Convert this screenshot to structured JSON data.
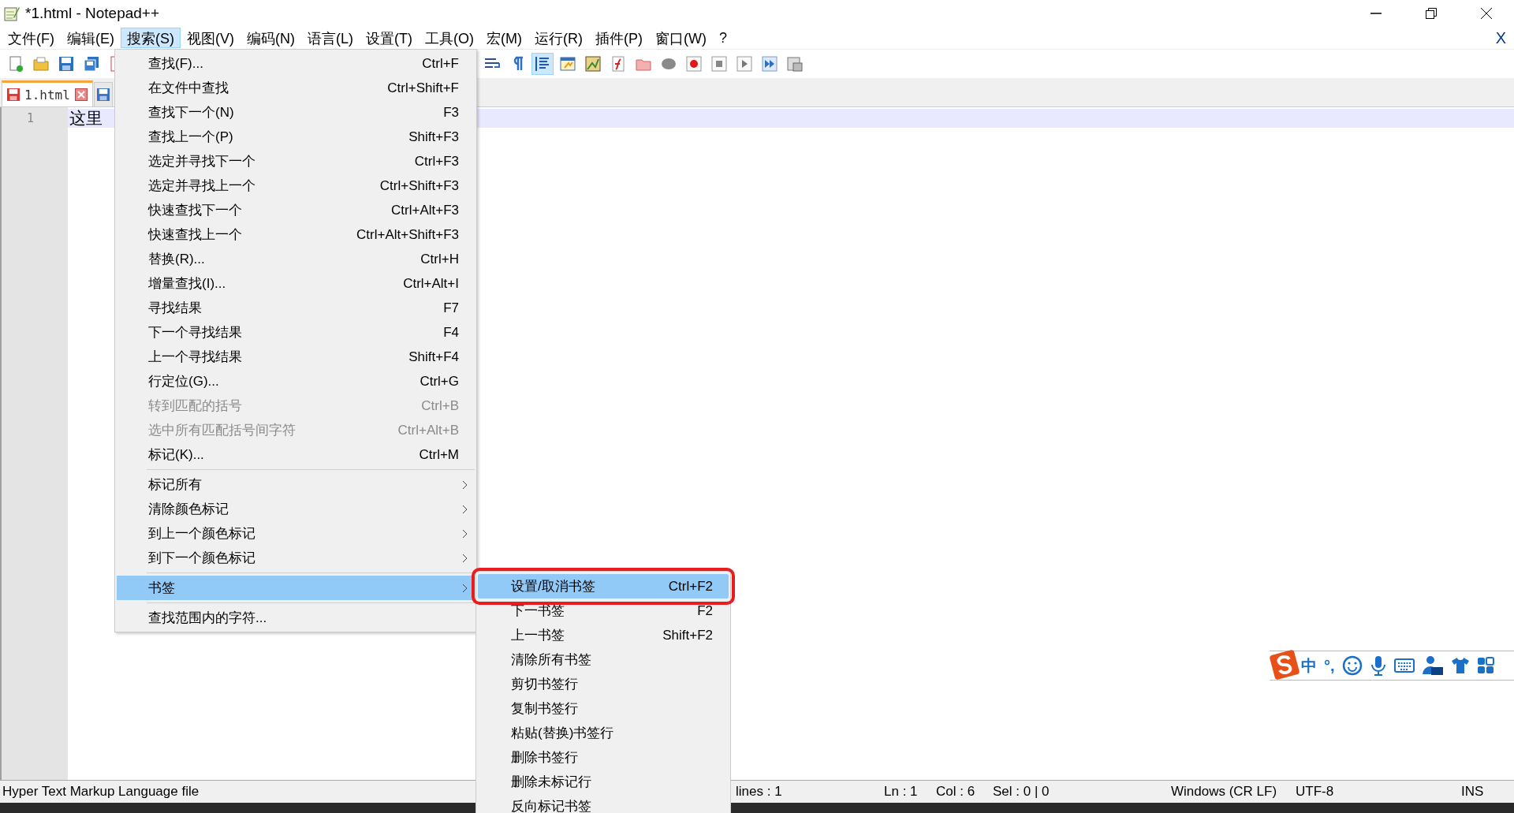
{
  "window": {
    "title": "*1.html - Notepad++"
  },
  "menubar": [
    {
      "label": "文件(F)",
      "selected": false
    },
    {
      "label": "编辑(E)",
      "selected": false
    },
    {
      "label": "搜索(S)",
      "selected": true
    },
    {
      "label": "视图(V)",
      "selected": false
    },
    {
      "label": "编码(N)",
      "selected": false
    },
    {
      "label": "语言(L)",
      "selected": false
    },
    {
      "label": "设置(T)",
      "selected": false
    },
    {
      "label": "工具(O)",
      "selected": false
    },
    {
      "label": "宏(M)",
      "selected": false
    },
    {
      "label": "运行(R)",
      "selected": false
    },
    {
      "label": "插件(P)",
      "selected": false
    },
    {
      "label": "窗口(W)",
      "selected": false
    },
    {
      "label": "?",
      "selected": false
    }
  ],
  "document_close": "X",
  "toolbar": [
    {
      "kind": "new",
      "pressed": false
    },
    {
      "kind": "open",
      "pressed": false
    },
    {
      "kind": "save",
      "pressed": false
    },
    {
      "kind": "save-all",
      "pressed": false
    },
    {
      "kind": "page",
      "pressed": false
    },
    {
      "kind": "wrap",
      "pressed": false
    },
    {
      "kind": "pilcrow",
      "pressed": false
    },
    {
      "kind": "indent",
      "pressed": true
    },
    {
      "kind": "window",
      "pressed": false
    },
    {
      "kind": "map",
      "pressed": false
    },
    {
      "kind": "function",
      "pressed": false
    },
    {
      "kind": "folder",
      "pressed": false
    },
    {
      "kind": "blob",
      "pressed": false
    },
    {
      "kind": "record",
      "pressed": false
    },
    {
      "kind": "stop",
      "pressed": false
    },
    {
      "kind": "play",
      "pressed": false
    },
    {
      "kind": "fast-forward",
      "pressed": false
    },
    {
      "kind": "list",
      "pressed": false
    }
  ],
  "tabs": [
    {
      "label": "1.html",
      "selected": true
    },
    {
      "selected": false
    }
  ],
  "editor": {
    "lines": [
      {
        "number": "1",
        "text": "这里",
        "current": true
      }
    ]
  },
  "search_menu": [
    {
      "kind": "command",
      "label": "查找(F)...",
      "shortcut": "Ctrl+F",
      "disabled": false,
      "selected": false
    },
    {
      "kind": "command",
      "label": "在文件中查找",
      "shortcut": "Ctrl+Shift+F",
      "disabled": false,
      "selected": false
    },
    {
      "kind": "command",
      "label": "查找下一个(N)",
      "shortcut": "F3",
      "disabled": false,
      "selected": false
    },
    {
      "kind": "command",
      "label": "查找上一个(P)",
      "shortcut": "Shift+F3",
      "disabled": false,
      "selected": false
    },
    {
      "kind": "command",
      "label": "选定并寻找下一个",
      "shortcut": "Ctrl+F3",
      "disabled": false,
      "selected": false
    },
    {
      "kind": "command",
      "label": "选定并寻找上一个",
      "shortcut": "Ctrl+Shift+F3",
      "disabled": false,
      "selected": false
    },
    {
      "kind": "command",
      "label": "快速查找下一个",
      "shortcut": "Ctrl+Alt+F3",
      "disabled": false,
      "selected": false
    },
    {
      "kind": "command",
      "label": "快速查找上一个",
      "shortcut": "Ctrl+Alt+Shift+F3",
      "disabled": false,
      "selected": false
    },
    {
      "kind": "command",
      "label": "替换(R)...",
      "shortcut": "Ctrl+H",
      "disabled": false,
      "selected": false
    },
    {
      "kind": "command",
      "label": "增量查找(I)...",
      "shortcut": "Ctrl+Alt+I",
      "disabled": false,
      "selected": false
    },
    {
      "kind": "command",
      "label": "寻找结果",
      "shortcut": "F7",
      "disabled": false,
      "selected": false
    },
    {
      "kind": "command",
      "label": "下一个寻找结果",
      "shortcut": "F4",
      "disabled": false,
      "selected": false
    },
    {
      "kind": "command",
      "label": "上一个寻找结果",
      "shortcut": "Shift+F4",
      "disabled": false,
      "selected": false
    },
    {
      "kind": "command",
      "label": "行定位(G)...",
      "shortcut": "Ctrl+G",
      "disabled": false,
      "selected": false
    },
    {
      "kind": "command",
      "label": "转到匹配的括号",
      "shortcut": "Ctrl+B",
      "disabled": true,
      "selected": false
    },
    {
      "kind": "command",
      "label": "选中所有匹配括号间字符",
      "shortcut": "Ctrl+Alt+B",
      "disabled": true,
      "selected": false
    },
    {
      "kind": "command",
      "label": "标记(K)...",
      "shortcut": "Ctrl+M",
      "disabled": false,
      "selected": false
    },
    {
      "kind": "separator"
    },
    {
      "kind": "submenu",
      "label": "标记所有",
      "disabled": false,
      "selected": false
    },
    {
      "kind": "submenu",
      "label": "清除颜色标记",
      "disabled": false,
      "selected": false
    },
    {
      "kind": "submenu",
      "label": "到上一个颜色标记",
      "disabled": false,
      "selected": false
    },
    {
      "kind": "submenu",
      "label": "到下一个颜色标记",
      "disabled": false,
      "selected": false
    },
    {
      "kind": "separator"
    },
    {
      "kind": "submenu",
      "label": "书签",
      "disabled": false,
      "selected": true
    },
    {
      "kind": "separator"
    },
    {
      "kind": "command",
      "label": "查找范围内的字符...",
      "disabled": false,
      "selected": false
    }
  ],
  "bookmark_submenu": [
    {
      "label": "设置/取消书签",
      "shortcut": "Ctrl+F2",
      "selected": true,
      "annotated": true
    },
    {
      "label": "下一书签",
      "shortcut": "F2",
      "selected": false,
      "annotated": false
    },
    {
      "label": "上一书签",
      "shortcut": "Shift+F2",
      "selected": false,
      "annotated": false
    },
    {
      "label": "清除所有书签",
      "selected": false,
      "annotated": false
    },
    {
      "label": "剪切书签行",
      "selected": false,
      "annotated": false
    },
    {
      "label": "复制书签行",
      "selected": false,
      "annotated": false
    },
    {
      "label": "粘贴(替换)书签行",
      "selected": false,
      "annotated": false
    },
    {
      "label": "删除书签行",
      "selected": false,
      "annotated": false
    },
    {
      "label": "删除未标记行",
      "selected": false,
      "annotated": false
    },
    {
      "label": "反向标记书签",
      "selected": false,
      "annotated": false
    }
  ],
  "status_bar": {
    "file_type": "Hyper Text Markup Language file",
    "lines": "lines : 1",
    "ln": "Ln : 1",
    "col": "Col : 6",
    "sel": "Sel : 0 | 0",
    "eol": "Windows (CR LF)",
    "encoding": "UTF-8",
    "mode": "INS"
  },
  "ime_toolbar": {
    "mode": "中",
    "punctuation": "°,"
  }
}
